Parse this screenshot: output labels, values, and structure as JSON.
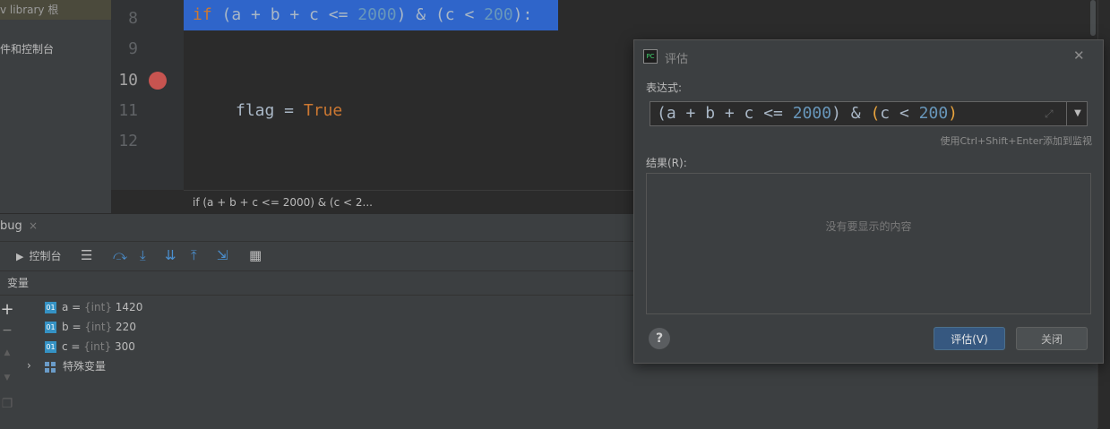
{
  "project": {
    "root_label": "v  library 根",
    "external_label": "件和控制台"
  },
  "editor": {
    "line_numbers": [
      "8",
      "9",
      "10",
      "11",
      "12"
    ],
    "line10": {
      "kw_if": "if",
      "open": " (a + b + c <= ",
      "n2000": "2000",
      "mid": ") & (c < ",
      "n200": "200",
      "close": "):"
    },
    "line11": {
      "flag": "flag = ",
      "true": "True"
    },
    "breadcrumb": "if (a + b + c <= 2000) & (c < 2..."
  },
  "debug": {
    "tab_label": "bug",
    "tab_close": "×",
    "console_label": "控制台",
    "variables_title": "变量",
    "variables": [
      {
        "icon": "01",
        "name": "a",
        "eq": " = ",
        "type": "{int}",
        "value": " 1420"
      },
      {
        "icon": "01",
        "name": "b",
        "eq": " = ",
        "type": "{int}",
        "value": " 220"
      },
      {
        "icon": "01",
        "name": "c",
        "eq": " = ",
        "type": "{int}",
        "value": " 300"
      }
    ],
    "special_vars": "特殊变量",
    "side": {
      "add": "+",
      "remove": "−",
      "up": "▲",
      "down": "▼",
      "copy": "❐"
    },
    "toolbar": {
      "console_icon": "▶",
      "menu": "☰",
      "step_over": "⤼",
      "step_into": "⤓",
      "step_into_mine": "⇊",
      "step_out": "⤒",
      "run_to_cursor": "⇲",
      "evaluate": "▦"
    }
  },
  "dialog": {
    "icon_text": "PC",
    "title": "评估",
    "close": "✕",
    "expr_label": "表达式:",
    "expr": {
      "p1": "(",
      "body1": "a + b + c <= ",
      "n2000": "2000",
      "mid": ") & ",
      "p2": "(",
      "c": "c < ",
      "n200": "200",
      "p3": ")"
    },
    "expand_icon": "⤢",
    "dropdown": "▼",
    "hint": "使用Ctrl+Shift+Enter添加到监视",
    "result_label": "结果(R):",
    "result_empty": "没有要显示的内容",
    "help": "?",
    "evaluate_button": "评估(V)",
    "close_button": "关闭"
  }
}
